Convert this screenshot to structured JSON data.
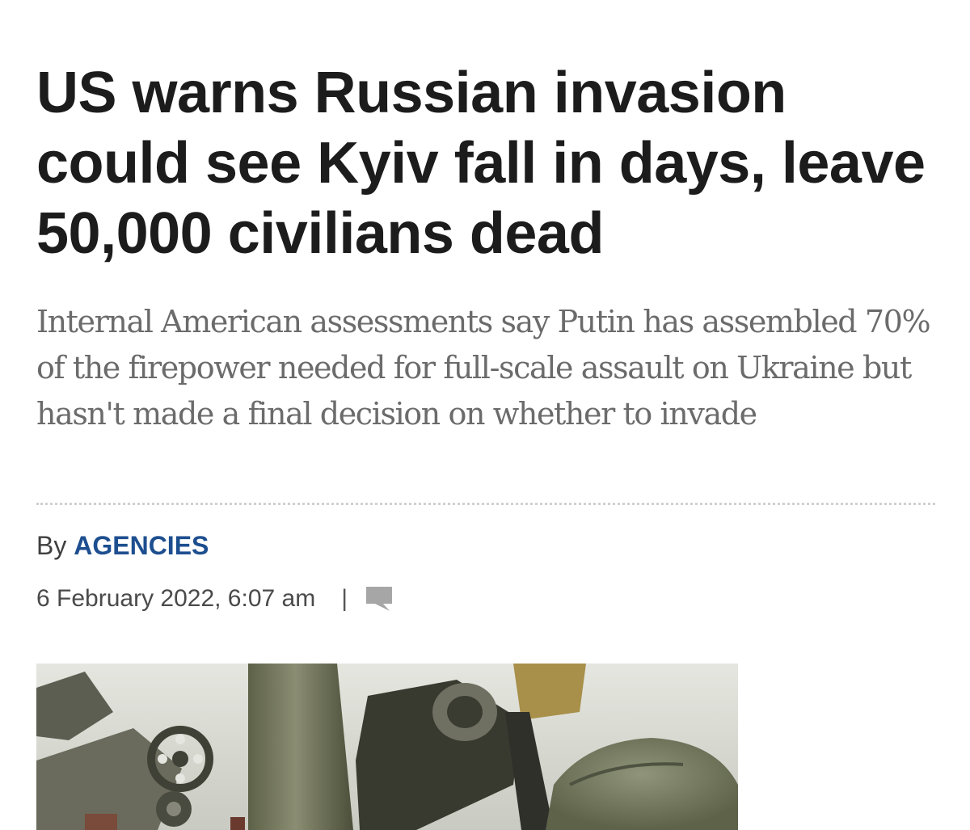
{
  "article": {
    "headline": "US warns Russian invasion could see Kyiv fall in days, leave 50,000 civilians dead",
    "subheadline": "Internal American assessments say Putin has assembled 70% of the firepower needed for full-scale assault on Ukraine but hasn't made a final decision on whether to invade",
    "byline_prefix": "By",
    "author": "AGENCIES",
    "date": "6 February 2022, 6:07 am",
    "separator": "|",
    "comment_icon": "comment-icon"
  },
  "colors": {
    "headline": "#1c1c1c",
    "subheadline": "#6b6b6b",
    "author_link": "#1d4e8f",
    "meta": "#4a4a4a",
    "comment_icon": "#a6a6a6"
  }
}
